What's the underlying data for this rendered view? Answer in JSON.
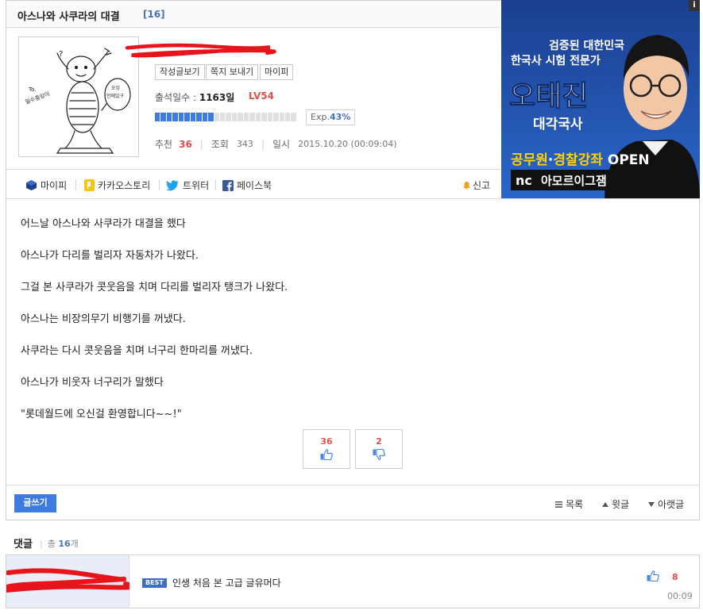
{
  "post": {
    "title": "아스나와 사쿠라의 대결",
    "comment_count_badge": "[16]"
  },
  "avatar": {
    "doodle_text_1": "To.",
    "doodle_text_2": "일수충잉이",
    "doodle_text_3": "오잉",
    "doodle_text_4": "안에있구",
    "doodle_text_5": "?"
  },
  "profile": {
    "buttons": [
      "작성글보기",
      "쪽지 보내기",
      "마이피"
    ],
    "attend_label": "출석일수 : ",
    "attend_value": "1163일",
    "level": "LV54",
    "exp_label": "Exp.",
    "exp_percent": "43%",
    "exp_fraction": 0.43
  },
  "meta": {
    "recommend_label": "추천",
    "recommend_value": "36",
    "views_label": "조회",
    "views_value": "343",
    "date_label": "일시",
    "date_value": "2015.10.20 (00:09:04)"
  },
  "share": {
    "items": [
      "마이피",
      "카카오스토리",
      "트위터",
      "페이스북"
    ],
    "report": "신고"
  },
  "ad": {
    "line1": "검증된 대한민국",
    "line2": "한국사 시험 전문가",
    "name": "오태진",
    "subject": "대각국사",
    "promo_a": "공무원",
    "promo_dot": "·",
    "promo_b": "경찰강좌",
    "promo_c": " OPEN",
    "brand_logo": "nc",
    "brand": "아모르이그잼",
    "info": "i"
  },
  "body": {
    "lines": [
      "어느날 아스나와 사쿠라가 대결을 했다",
      "아스나가 다리를 벌리자 자동차가 나왔다.",
      "그걸 본 사쿠라가 콧웃음을 치며 다리를 벌리자 탱크가 나왔다.",
      "아스나는 비장의무기 비행기를 꺼냈다.",
      "사쿠라는 다시 콧웃음을 치며 너구리 한마리를 꺼냈다.",
      "아스나가 비웃자 너구리가 말했다",
      "\"롯데월드에 오신걸 환영합니다~~!\""
    ]
  },
  "votes": {
    "up": "36",
    "down": "2"
  },
  "actions": {
    "write": "글쓰기",
    "list": "목록",
    "prev": "윗글",
    "next": "아랫글"
  },
  "comments": {
    "header": "댓글",
    "total_prefix": "총 ",
    "total_value": "16",
    "total_suffix": "개",
    "items": [
      {
        "badge": "BEST",
        "text": "인생 처음 본 고급 글유머다",
        "likes": "8",
        "time": "00:09"
      }
    ]
  },
  "colors": {
    "accent_blue": "#3d7be0",
    "red": "#d9534f",
    "censor_red": "#e8141b",
    "ad_bg": "#1e4da0"
  }
}
